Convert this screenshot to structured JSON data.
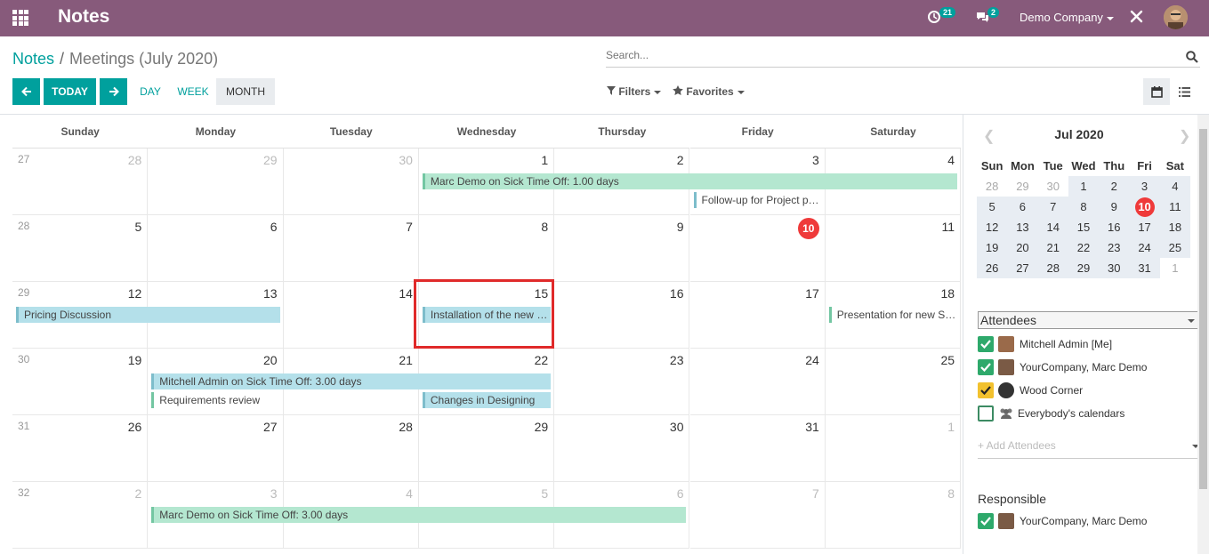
{
  "topbar": {
    "app_title": "Notes",
    "activity_count": "21",
    "messages_count": "2",
    "company": "Demo Company"
  },
  "breadcrumb": {
    "parent": "Notes",
    "current": "Meetings (July 2020)"
  },
  "search": {
    "placeholder": "Search..."
  },
  "nav": {
    "today": "TODAY",
    "day": "DAY",
    "week": "WEEK",
    "month": "MONTH"
  },
  "filters": {
    "filters_label": "Filters",
    "favorites_label": "Favorites"
  },
  "calendar": {
    "day_headers": [
      "Sunday",
      "Monday",
      "Tuesday",
      "Wednesday",
      "Thursday",
      "Friday",
      "Saturday"
    ],
    "weeks": [
      {
        "week_no": "27",
        "days": [
          "28",
          "29",
          "30",
          "1",
          "2",
          "3",
          "4"
        ],
        "other": [
          true,
          true,
          true,
          false,
          false,
          false,
          false
        ]
      },
      {
        "week_no": "28",
        "days": [
          "5",
          "6",
          "7",
          "8",
          "9",
          "10",
          "11"
        ],
        "other": [
          false,
          false,
          false,
          false,
          false,
          false,
          false
        ]
      },
      {
        "week_no": "29",
        "days": [
          "12",
          "13",
          "14",
          "15",
          "16",
          "17",
          "18"
        ],
        "other": [
          false,
          false,
          false,
          false,
          false,
          false,
          false
        ]
      },
      {
        "week_no": "30",
        "days": [
          "19",
          "20",
          "21",
          "22",
          "23",
          "24",
          "25"
        ],
        "other": [
          false,
          false,
          false,
          false,
          false,
          false,
          false
        ]
      },
      {
        "week_no": "31",
        "days": [
          "26",
          "27",
          "28",
          "29",
          "30",
          "31",
          "1"
        ],
        "other": [
          false,
          false,
          false,
          false,
          false,
          false,
          true
        ]
      },
      {
        "week_no": "32",
        "days": [
          "2",
          "3",
          "4",
          "5",
          "6",
          "7",
          "8"
        ],
        "other": [
          true,
          true,
          true,
          true,
          true,
          true,
          true
        ]
      }
    ],
    "today_day": "10",
    "events": [
      {
        "title": "Marc Demo on Sick Time Off: 1.00 days"
      },
      {
        "title": "Follow-up for Project proposal"
      },
      {
        "title": "Pricing Discussion"
      },
      {
        "title": "Installation of the new server"
      },
      {
        "title": "Presentation for new Services"
      },
      {
        "title": "Mitchell Admin on Sick Time Off: 3.00 days"
      },
      {
        "title": "Requirements review"
      },
      {
        "title": "Changes in Designing"
      },
      {
        "title": "Marc Demo on Sick Time Off: 3.00 days"
      }
    ]
  },
  "sidebar": {
    "mini_title": "Jul 2020",
    "mini_headers": [
      "Sun",
      "Mon",
      "Tue",
      "Wed",
      "Thu",
      "Fri",
      "Sat"
    ],
    "mini_rows": [
      [
        "28",
        "29",
        "30",
        "1",
        "2",
        "3",
        "4"
      ],
      [
        "5",
        "6",
        "7",
        "8",
        "9",
        "10",
        "11"
      ],
      [
        "12",
        "13",
        "14",
        "15",
        "16",
        "17",
        "18"
      ],
      [
        "19",
        "20",
        "21",
        "22",
        "23",
        "24",
        "25"
      ],
      [
        "26",
        "27",
        "28",
        "29",
        "30",
        "31",
        "1"
      ]
    ],
    "attendees_label": "Attendees",
    "attendees": [
      {
        "name": "Mitchell Admin [Me]"
      },
      {
        "name": "YourCompany, Marc Demo"
      },
      {
        "name": "Wood Corner"
      },
      {
        "name": "Everybody's calendars"
      }
    ],
    "add_attendees": "+ Add Attendees",
    "responsible_label": "Responsible",
    "responsible": [
      {
        "name": "YourCompany, Marc Demo"
      }
    ]
  },
  "colors": {
    "brand": "#875a7b",
    "primary": "#00a09d",
    "today": "#ef3a3a",
    "event_green": "#b4e7d0",
    "event_blue": "#b4e0ea",
    "highlight": "#e02a2a"
  }
}
